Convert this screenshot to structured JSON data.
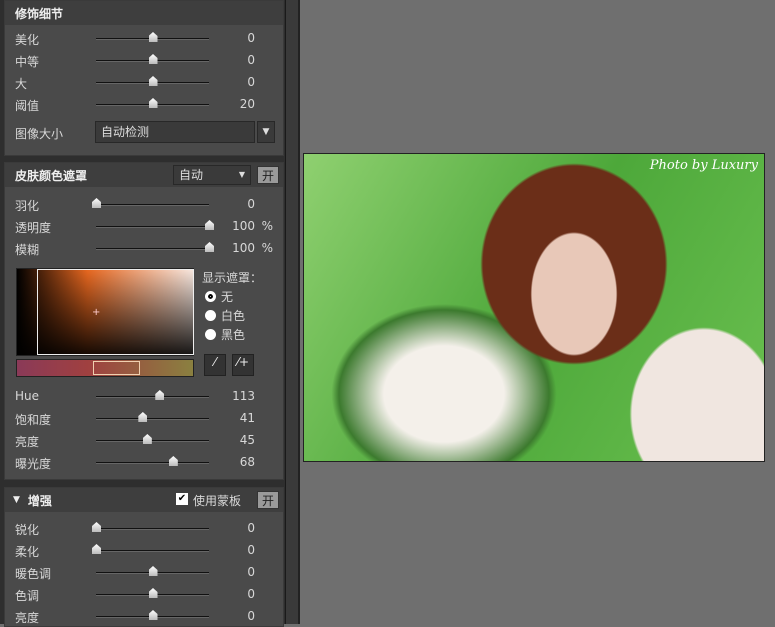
{
  "detail": {
    "title": "修饰细节",
    "sliders": [
      {
        "label": "美化",
        "value": "0",
        "pos": 0.5
      },
      {
        "label": "中等",
        "value": "0",
        "pos": 0.5
      },
      {
        "label": "大",
        "value": "0",
        "pos": 0.5
      },
      {
        "label": "阈值",
        "value": "20",
        "pos": 0.5
      }
    ],
    "image_size_label": "图像大小",
    "image_size_value": "自动检测"
  },
  "skin": {
    "title": "皮肤颜色遮罩",
    "mode": "自动",
    "toggle": "开",
    "sliders": [
      {
        "label": "羽化",
        "value": "0",
        "pos": 0,
        "unit": ""
      },
      {
        "label": "透明度",
        "value": "100",
        "pos": 1,
        "unit": "%"
      },
      {
        "label": "模糊",
        "value": "100",
        "pos": 1,
        "unit": "%"
      }
    ],
    "show_mask_label": "显示遮罩：",
    "mask_options": [
      "无",
      "白色",
      "黑色"
    ],
    "mask_selected": 0,
    "hsl": [
      {
        "label": "Hue",
        "value": "113",
        "pos": 0.56
      },
      {
        "label": "饱和度",
        "value": "41",
        "pos": 0.41
      },
      {
        "label": "亮度",
        "value": "45",
        "pos": 0.45
      },
      {
        "label": "曝光度",
        "value": "68",
        "pos": 0.68
      }
    ]
  },
  "enhance": {
    "title": "增强",
    "use_mask_label": "使用蒙板",
    "use_mask_checked": true,
    "toggle": "开",
    "sliders": [
      {
        "label": "锐化",
        "value": "0",
        "pos": 0
      },
      {
        "label": "柔化",
        "value": "0",
        "pos": 0
      },
      {
        "label": "暖色调",
        "value": "0",
        "pos": 0.5
      },
      {
        "label": "色调",
        "value": "0",
        "pos": 0.5
      },
      {
        "label": "亮度",
        "value": "0",
        "pos": 0.5
      }
    ]
  },
  "photo": {
    "watermark": "Photo by Luxury"
  }
}
